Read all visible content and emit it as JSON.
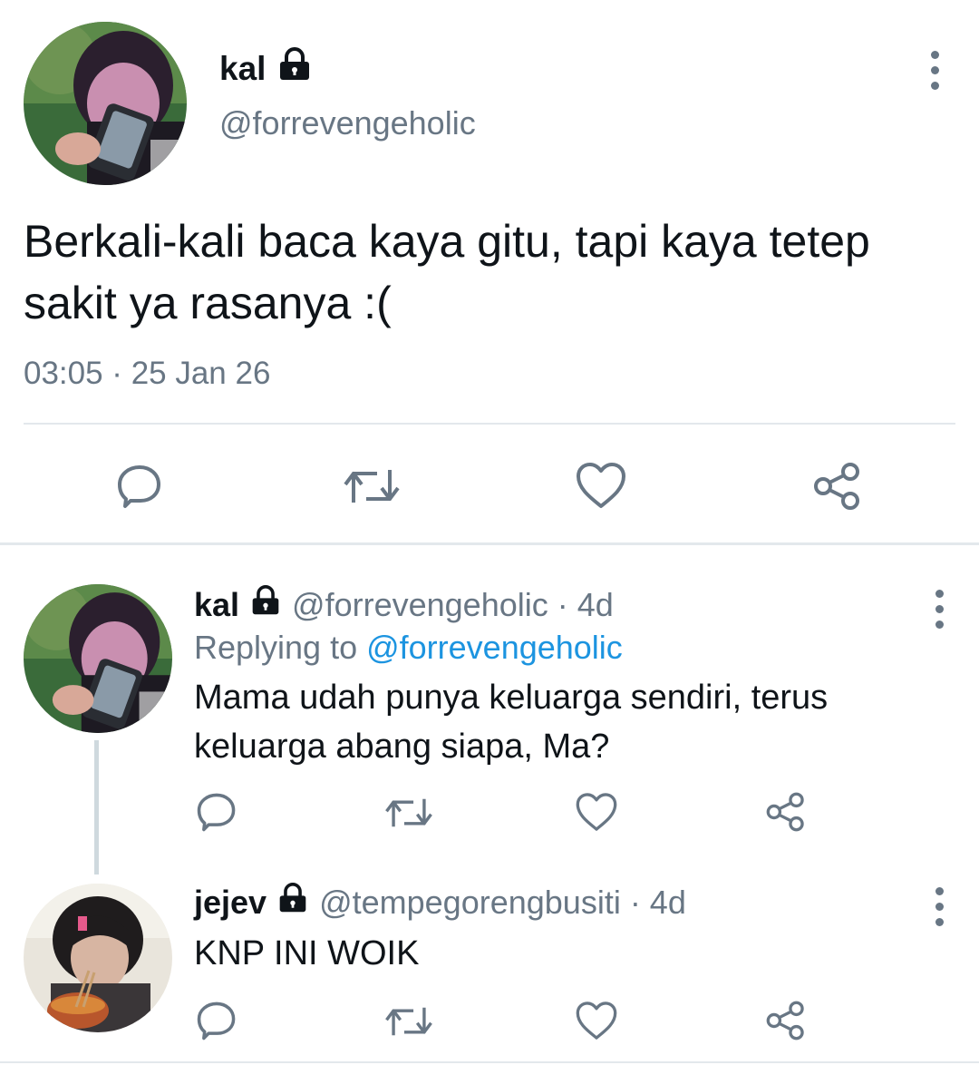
{
  "main_tweet": {
    "display_name": "kal",
    "handle": "@forrevengeholic",
    "text_lines": [
      "Berkali-kali baca kaya gitu, tapi kaya tetep",
      "sakit ya rasanya :("
    ],
    "timestamp": "03:05 · 25 Jan 26",
    "actions": [
      "reply-icon",
      "retweet-icon",
      "like-icon",
      "share-icon"
    ]
  },
  "replies": [
    {
      "display_name": "kal",
      "handle_time": "@forrevengeholic · 4d",
      "replying_prefix": "Replying to ",
      "replying_mention": "@forrevengeholic",
      "text_lines": [
        "Mama udah punya keluarga sendiri, terus",
        "keluarga abang siapa, Ma?"
      ]
    },
    {
      "display_name": "jejev",
      "handle_time": "@tempegorengbusiti · 4d",
      "text_lines": [
        "KNP INI WOIK"
      ]
    }
  ],
  "colors": {
    "text_primary": "#0f1419",
    "text_secondary": "#687684",
    "link": "#1c94e0",
    "divider": "#e3e8ec",
    "thread_line": "#cfd9de",
    "icon": "#687684"
  }
}
